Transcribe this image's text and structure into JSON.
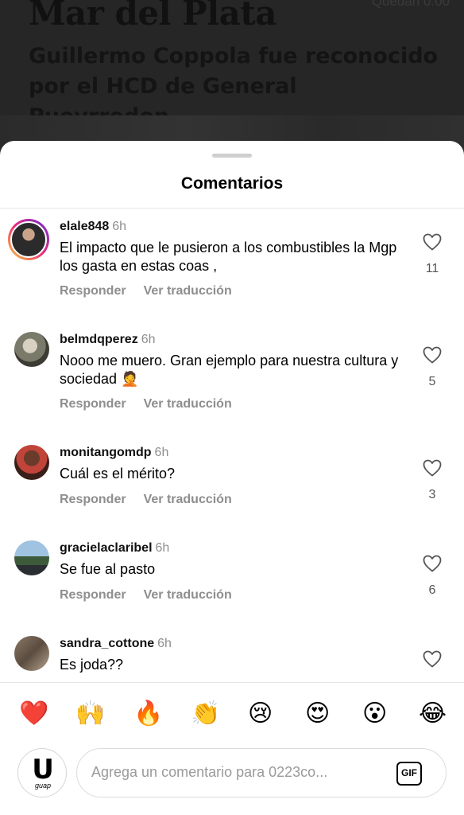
{
  "background_post": {
    "city": "Mar del Plata",
    "headline": "Guillermo Coppola fue reconocido por el HCD de General Pueyrredon",
    "timer": "Quedan 0:00"
  },
  "sheet": {
    "title": "Comentarios"
  },
  "actions": {
    "reply": "Responder",
    "translate": "Ver traducción"
  },
  "comments": [
    {
      "username": "elale848",
      "time": "6h",
      "text": "El impacto que le pusieron a los combustibles la Mgp los gasta en estas coas ,",
      "likes": "11"
    },
    {
      "username": "belmdqperez",
      "time": "6h",
      "text": "Nooo me muero. Gran ejemplo para nuestra cultura y sociedad 🤦",
      "likes": "5"
    },
    {
      "username": "monitangomdp",
      "time": "6h",
      "text": "Cuál es el mérito?",
      "likes": "3"
    },
    {
      "username": "gracielaclaribel",
      "time": "6h",
      "text": "Se fue al pasto",
      "likes": "6"
    },
    {
      "username": "sandra_cottone",
      "time": "6h",
      "text": "Es joda??",
      "likes": ""
    }
  ],
  "reactions": [
    "❤️",
    "🙌",
    "🔥",
    "👏",
    "😢",
    "😍",
    "😮",
    "😂"
  ],
  "composer": {
    "avatar_letter": "U",
    "avatar_sub": "guap",
    "placeholder": "Agrega un comentario para 0223co...",
    "gif_label": "GIF"
  }
}
